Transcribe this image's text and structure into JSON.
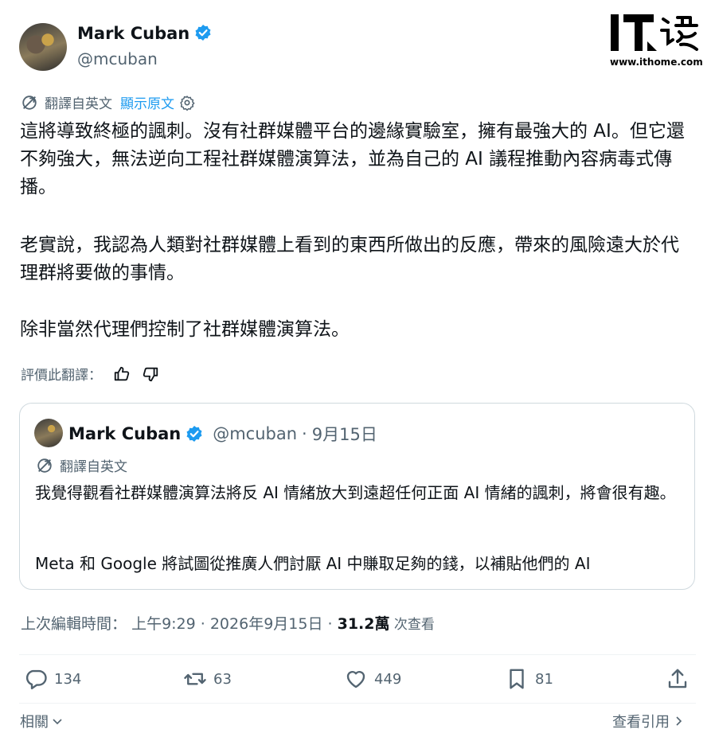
{
  "author": {
    "name": "Mark Cuban",
    "handle": "@mcuban",
    "verified": true,
    "avatar_icon": "user-avatar"
  },
  "watermark": {
    "logo_text": "IT之家",
    "url": "www.ithome.com"
  },
  "translation": {
    "label": "翻譯自英文",
    "show_original": "顯示原文",
    "icon": "translate-icon"
  },
  "tweet": {
    "paragraphs": [
      "這將導致終極的諷刺。沒有社群媒體平台的邊緣實驗室，擁有最強大的 AI。但它還不夠強大，無法逆向工程社群媒體演算法，並為自己的 AI 議程推動內容病毒式傳播。",
      "老實說，我認為人類對社群媒體上看到的東西所做出的反應，帶來的風險遠大於代理群將要做的事情。",
      "除非當然代理們控制了社群媒體演算法。"
    ]
  },
  "rate_translation": {
    "label": "評價此翻譯："
  },
  "quoted": {
    "name": "Mark Cuban",
    "handle": "@mcuban",
    "separator": "·",
    "date": "9月15日",
    "translation_label": "翻譯自英文",
    "paragraphs": [
      "我覺得觀看社群媒體演算法將反 AI 情緒放大到遠超任何正面 AI 情緒的諷刺，將會很有趣。",
      "Meta 和 Google 將試圖從推廣人們討厭 AI 中賺取足夠的錢，以補貼他們的 AI"
    ]
  },
  "meta": {
    "edited_label": "上次編輯時間：",
    "time": "上午9:29 · 2026年9月15日 · ",
    "views_count": "31.2萬",
    "views_label": " 次查看"
  },
  "actions": {
    "replies": "134",
    "retweets": "63",
    "likes": "449",
    "bookmarks": "81"
  },
  "footer": {
    "related": "相關",
    "view_quotes": "查看引用"
  },
  "colors": {
    "accent": "#1d9bf0",
    "text": "#0f1419",
    "secondary": "#536471",
    "border": "#cfd9de"
  }
}
